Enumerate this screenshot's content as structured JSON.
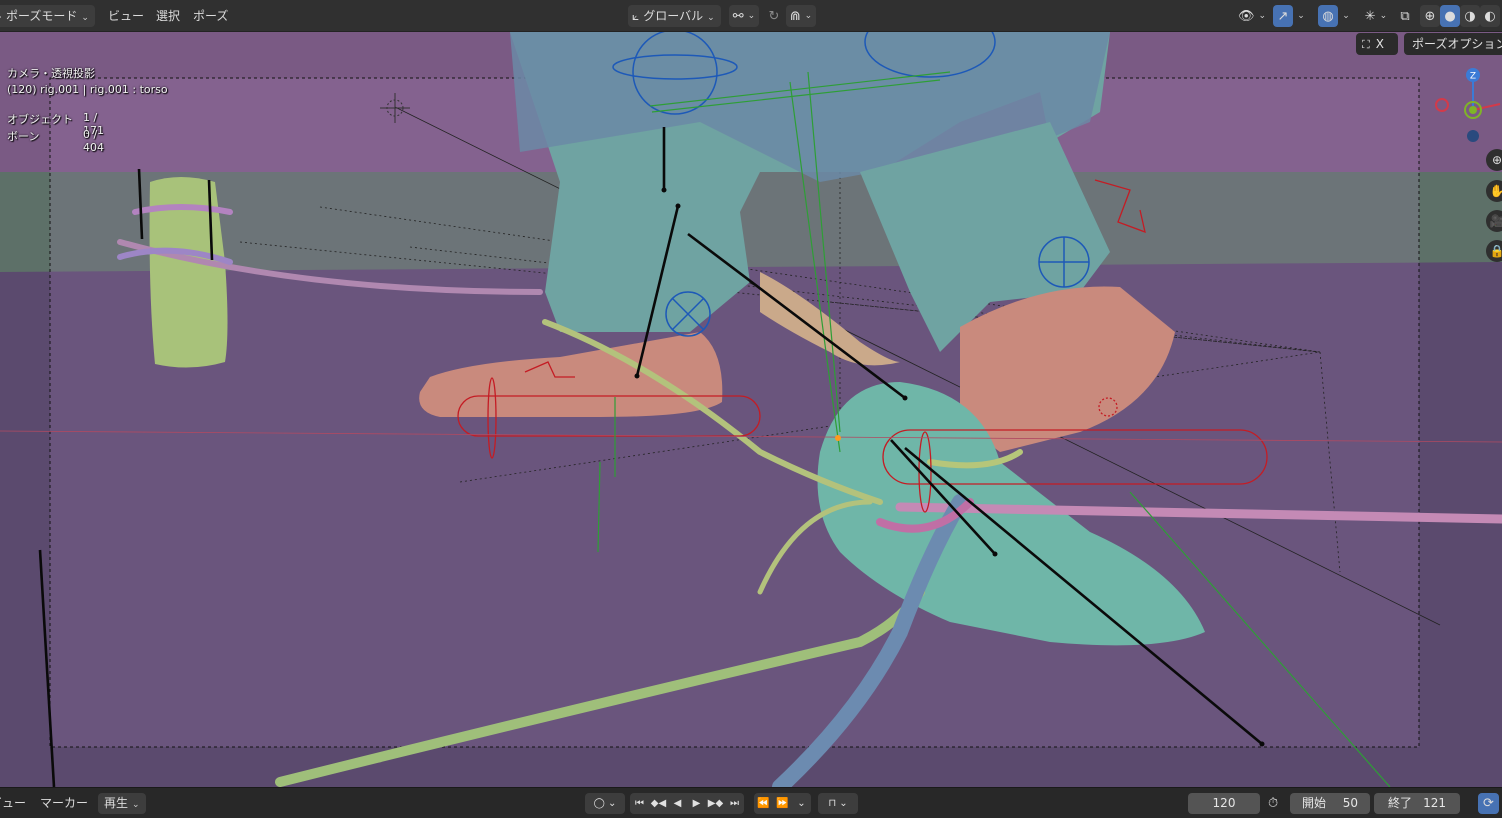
{
  "header": {
    "mode": "ポーズモード",
    "menus": [
      "ビュー",
      "選択",
      "ポーズ"
    ],
    "transform_orientation": "グローバル"
  },
  "viewport": {
    "camera_label": "カメラ・透視投影",
    "object_info": "(120) rig.001 | rig.001 : torso",
    "stats": [
      {
        "label": "オブジェクト",
        "value": "1 / 171"
      },
      {
        "label": "ボーン",
        "value": "0 / 404"
      }
    ],
    "options_close": "X",
    "options_label": "ポーズオプション",
    "gizmo_axis_z": "Z"
  },
  "timeline": {
    "menus": [
      "ビュー",
      "マーカー"
    ],
    "playback": "再生",
    "current_frame": "120",
    "start_label": "開始",
    "start_value": "50",
    "end_label": "終了",
    "end_value": "121"
  },
  "colors": {
    "accent": "#4772b3",
    "header_bg": "#303030",
    "viewport_bg": "#5a4a6b",
    "axis_x": "#d23a4a",
    "axis_y": "#7fb428",
    "axis_z": "#3b7bd6"
  },
  "icons": [
    "arrow-left-icon",
    "orientation-icon",
    "pivot-icon",
    "snap-icon",
    "proportional-icon",
    "visibility-icon",
    "gizmo-icon",
    "overlay-icon",
    "xray-icon",
    "shading-wire-icon",
    "shading-solid-icon",
    "shading-material-icon",
    "shading-render-icon",
    "zoom-icon",
    "hand-icon",
    "camera-icon",
    "lock-icon",
    "keyframe-icon",
    "jump-start-icon",
    "prev-keyframe-icon",
    "play-reverse-icon",
    "play-icon",
    "next-keyframe-icon",
    "jump-end-icon",
    "auto-key-icon",
    "timer-icon"
  ]
}
